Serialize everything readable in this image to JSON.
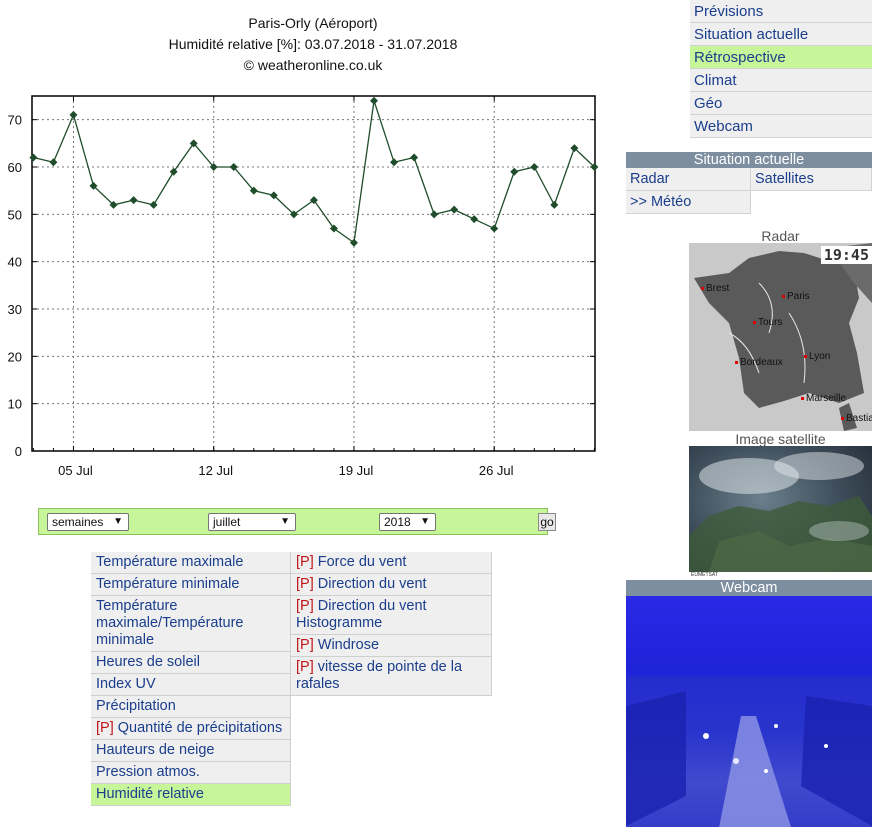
{
  "chart_header": {
    "station": "Paris-Orly (Aéroport)",
    "parameter_range": "Humidité relative [%]: 03.07.2018 - 31.07.2018",
    "copyright": "© weatheronline.co.uk"
  },
  "chart_data": {
    "type": "line",
    "title": "Paris-Orly (Aéroport)",
    "subtitle": "Humidité relative [%]: 03.07.2018 - 31.07.2018",
    "x_tick_labels": [
      "05 Jul",
      "12 Jul",
      "19 Jul",
      "26 Jul"
    ],
    "x_tick_days": [
      5,
      12,
      19,
      26
    ],
    "x_range": [
      3,
      31
    ],
    "y_ticks": [
      0,
      10,
      20,
      30,
      40,
      50,
      60,
      70
    ],
    "ylim": [
      0,
      75
    ],
    "grid": true,
    "series": [
      {
        "days": [
          3,
          4,
          5,
          6,
          7,
          8,
          9,
          10,
          11,
          12,
          13,
          14,
          15,
          16,
          17,
          18,
          19,
          20,
          21,
          22,
          23,
          24,
          25,
          26,
          27,
          28,
          29,
          30,
          31
        ],
        "values": [
          62,
          61,
          71,
          56,
          52,
          53,
          52,
          59,
          65,
          60,
          60,
          55,
          54,
          50,
          53,
          47,
          44,
          74,
          61,
          62,
          50,
          51,
          49,
          47,
          59,
          60,
          52,
          64,
          60
        ],
        "color": "#1f4d2b"
      }
    ]
  },
  "period_selector": {
    "unit": "semaines",
    "month": "juillet",
    "year": "2018",
    "go_label": "go"
  },
  "parameters_left": [
    {
      "p": "",
      "label": "Température maximale"
    },
    {
      "p": "",
      "label": "Température minimale"
    },
    {
      "p": "",
      "label": "Température maximale/Température minimale"
    },
    {
      "p": "",
      "label": "Heures de soleil"
    },
    {
      "p": "",
      "label": "Index UV"
    },
    {
      "p": "",
      "label": "Précipitation"
    },
    {
      "p": "[P]",
      "label": " Quantité de précipitations"
    },
    {
      "p": "",
      "label": "Hauteurs de neige"
    },
    {
      "p": "",
      "label": "Pression atmos."
    },
    {
      "p": "",
      "label": "Humidité relative"
    }
  ],
  "parameters_right": [
    {
      "p": "[P]",
      "label": " Force du vent"
    },
    {
      "p": "[P]",
      "label": " Direction du vent"
    },
    {
      "p": "[P]",
      "label": " Direction du vent Histogramme"
    },
    {
      "p": "[P]",
      "label": " Windrose"
    },
    {
      "p": "[P]",
      "label": " vitesse de pointe de la rafales"
    }
  ],
  "nav": [
    "Prévisions",
    "Situation actuelle",
    "Rétrospective",
    "Climat",
    "Géo",
    "Webcam"
  ],
  "current_box": {
    "header": "Situation actuelle",
    "radar": "Radar",
    "satellites": "Satellites",
    "meteo": ">> Météo"
  },
  "radar": {
    "caption": "Radar",
    "timestamp": "19:45",
    "cities": [
      "Brest",
      "Paris",
      "Tours",
      "Bordeaux",
      "Lyon",
      "Marseille",
      "Bastia"
    ]
  },
  "satellite": {
    "caption": "Image satellite",
    "credit": "EUMETSAT"
  },
  "webcam": {
    "header": "Webcam"
  },
  "colors": {
    "accent_green": "#c6f59a",
    "link_blue": "#1a3e8c",
    "header_gray": "#7d8ea0",
    "premium_red": "#c0161b"
  }
}
